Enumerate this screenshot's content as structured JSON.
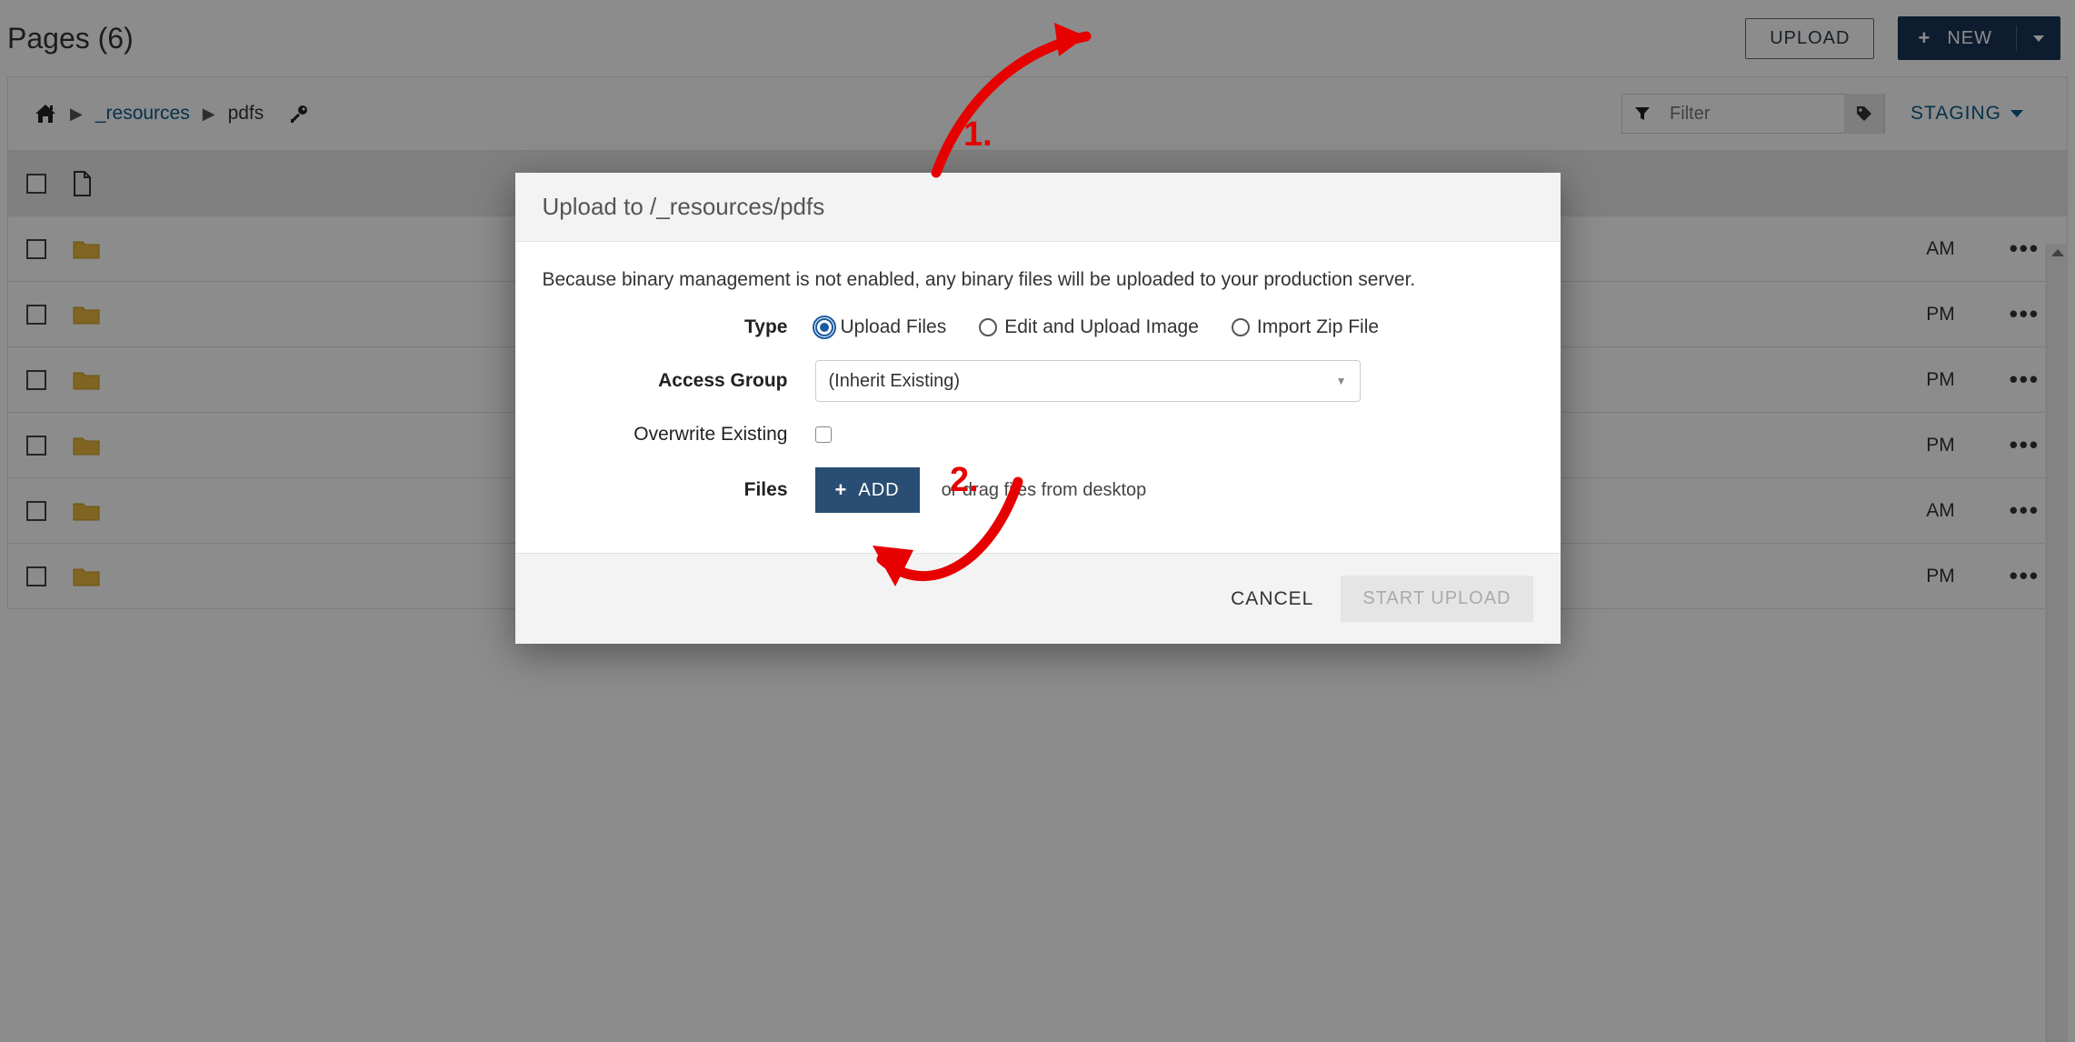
{
  "header": {
    "title": "Pages (6)",
    "upload_label": "UPLOAD",
    "new_label": "NEW"
  },
  "toolbar": {
    "breadcrumb": {
      "resources": "_resources",
      "current": "pdfs"
    },
    "filter_placeholder": "Filter",
    "staging_label": "STAGING"
  },
  "rows": [
    {
      "time": "AM"
    },
    {
      "time": "PM"
    },
    {
      "time": "PM"
    },
    {
      "time": "PM"
    },
    {
      "time": "AM"
    },
    {
      "time": "PM"
    }
  ],
  "modal": {
    "title": "Upload to /_resources/pdfs",
    "note": "Because binary management is not enabled, any binary files will be uploaded to your production server.",
    "labels": {
      "type": "Type",
      "access_group": "Access Group",
      "overwrite": "Overwrite Existing",
      "files": "Files"
    },
    "type_options": {
      "upload_files": "Upload Files",
      "edit_upload_image": "Edit and Upload Image",
      "import_zip": "Import Zip File"
    },
    "access_group_value": "(Inherit Existing)",
    "add_label": "ADD",
    "drag_text": "or drag files from desktop",
    "cancel_label": "CANCEL",
    "start_label": "START UPLOAD"
  },
  "annotations": {
    "one": "1.",
    "two": "2."
  }
}
